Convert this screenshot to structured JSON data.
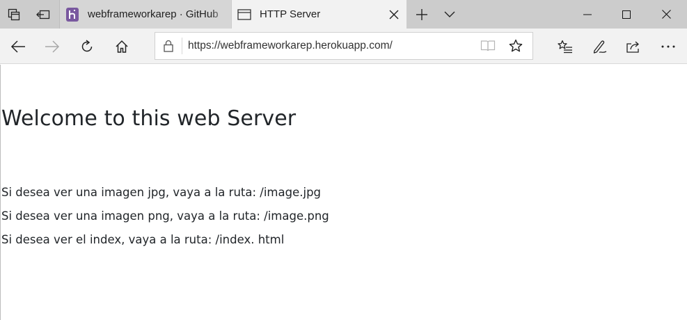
{
  "tabs": [
    {
      "title": "webframeworkarep · GitHub",
      "favicon": "heroku-icon"
    },
    {
      "title": "HTTP Server",
      "favicon": "page-icon",
      "active": true
    }
  ],
  "address_bar": {
    "url": "https://webframeworkarep.herokuapp.com/"
  },
  "page": {
    "heading": "Welcome to this web Server",
    "lines": [
      "Si desea ver una imagen jpg, vaya a la ruta: /image.jpg",
      "Si desea ver una imagen png, vaya a la ruta: /image.png",
      "Si desea ver el index, vaya a la ruta: /index. html"
    ]
  },
  "colors": {
    "tabstrip_bg": "#cccccc",
    "toolbar_bg": "#f2f2f2",
    "heroku_purple": "#79589f",
    "text": "#212529"
  }
}
